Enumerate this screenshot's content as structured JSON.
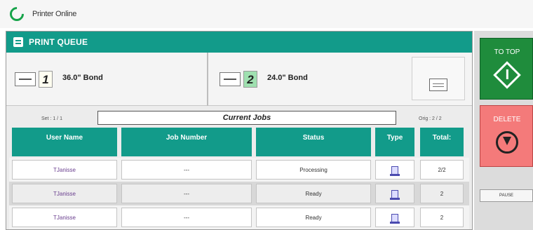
{
  "status": {
    "text": "Printer Online",
    "color": "#16a34a"
  },
  "queue": {
    "title": "PRINT QUEUE"
  },
  "trays": [
    {
      "number": "1",
      "paper": "36.0\" Bond"
    },
    {
      "number": "2",
      "paper": "24.0\" Bond"
    }
  ],
  "jobs": {
    "set_label": "Set : 1 / 1",
    "orig_label": "Orig : 2 / 2",
    "current_label": "Current Jobs",
    "columns": [
      "User Name",
      "Job Number",
      "Status",
      "Type",
      "Total:"
    ],
    "rows": [
      {
        "user": "TJanisse",
        "job": "---",
        "status": "Processing",
        "total": "2/2"
      },
      {
        "user": "TJanisse",
        "job": "---",
        "status": "Ready",
        "total": "2"
      },
      {
        "user": "TJanisse",
        "job": "---",
        "status": "Ready",
        "total": "2"
      }
    ]
  },
  "side_buttons": {
    "top_label": "TO TOP",
    "delete_label": "DELETE",
    "pause_label": "PAUSE"
  },
  "colors": {
    "header_teal": "#129b8a",
    "top_green": "#1f8c3c",
    "delete_red": "#f47a7a"
  },
  "icons": [
    "status-ring-icon",
    "queue-list-icon",
    "envelope-icon",
    "tray-settings-icon",
    "document-type-icon",
    "start-diamond-icon",
    "stop-circle-icon"
  ]
}
